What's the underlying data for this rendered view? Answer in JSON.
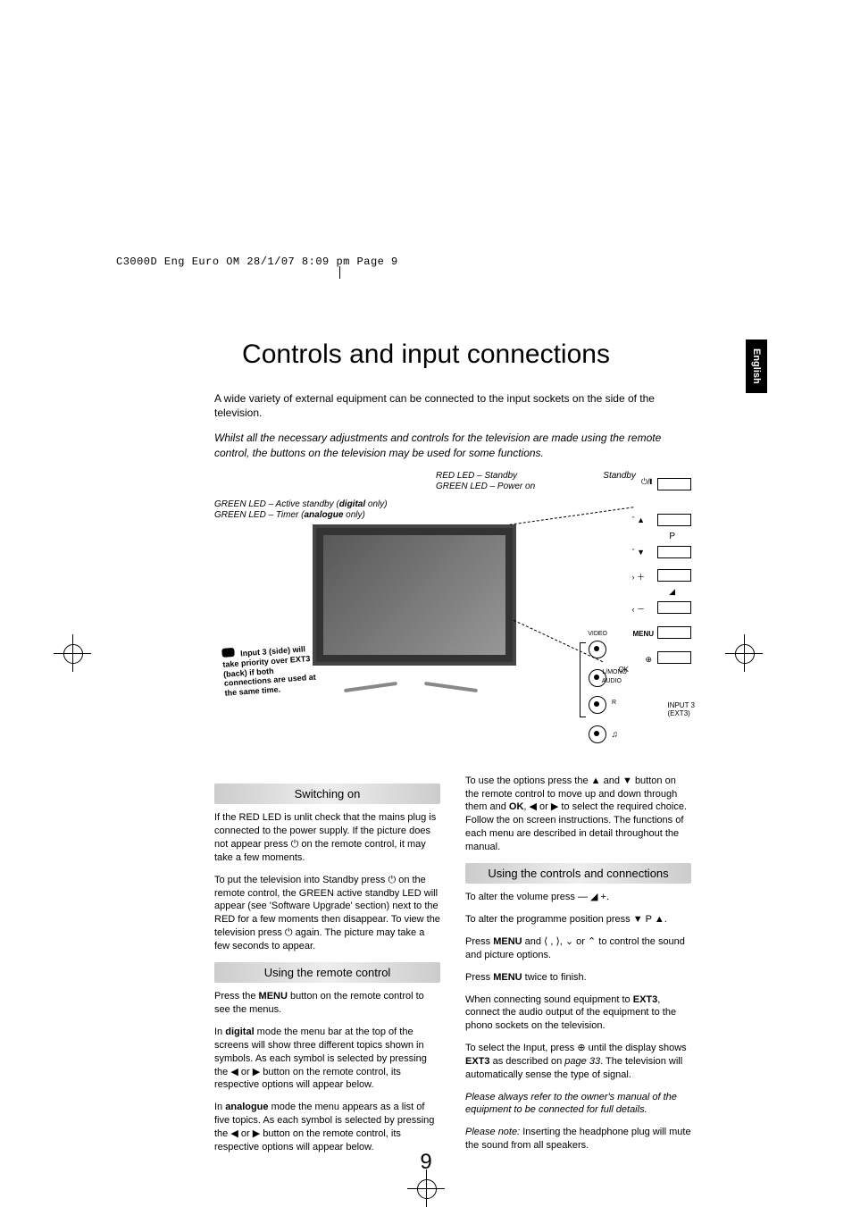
{
  "meta": {
    "print_header": "C3000D Eng Euro OM  28/1/07  8:09 pm  Page 9"
  },
  "language_tab": "English",
  "title": "Controls and input connections",
  "intro": {
    "line1": "A wide variety of external equipment can be connected to the input sockets on the side of the television.",
    "line2": "Whilst all the necessary adjustments and controls for the television are made using the remote control, the buttons on the television may be used for some functions."
  },
  "diagram": {
    "led_top_a": "RED LED – Standby",
    "led_top_b": "GREEN LED – Power on",
    "standby_label": "Standby",
    "led_left_a_pre": "GREEN LED – Active standby (",
    "led_left_a_bold": "digital",
    "led_left_a_post": " only)",
    "led_left_b_pre": "GREEN LED – Timer (",
    "led_left_b_bold": "analogue",
    "led_left_b_post": " only)",
    "sticky_note": "Input 3 (side) will take priority over EXT3 (back) if both connections are used at the same time.",
    "panel": {
      "p_sym": "P",
      "vol_sym": "◢",
      "menu": "MENU",
      "ok": "OK",
      "input3": "INPUT 3",
      "input3_sub": "(EXT3)",
      "video": "VIDEO",
      "l_mono": "L/MONO",
      "audio": "AUDIO",
      "r": "R",
      "headphone": "♫"
    }
  },
  "sections": {
    "switching_on": {
      "heading": "Switching on",
      "p1": "If the RED LED is unlit check that the mains plug is connected to the power supply. If the picture does not appear press ⏻ on the remote control, it may take a few moments.",
      "p2": "To put the television into Standby press ⏻ on the remote control, the GREEN active standby LED will appear (see 'Software Upgrade' section) next to the RED for a few moments then disappear. To view the television press ⏻ again. The picture may take a few seconds to appear."
    },
    "using_remote": {
      "heading": "Using the remote control",
      "p1_pre": "Press the ",
      "p1_bold": "MENU",
      "p1_post": " button on the remote control to see the menus.",
      "p2_pre": "In ",
      "p2_bold": "digital",
      "p2_mid": " mode the menu bar at the top of the screens will show three different topics shown in symbols. As each symbol is selected by pressing the ◀ or ▶ button on the remote control, its respective options will appear below.",
      "p3_pre": "In ",
      "p3_bold": "analogue",
      "p3_mid": " mode the menu appears as a list of five topics. As each symbol is selected by pressing the ◀ or ▶ button on the remote control, its respective options will appear below."
    },
    "right_top": {
      "p1_pre": "To use the options press the ▲ and ▼ button on the remote control to move up and down through them and ",
      "p1_bold": "OK",
      "p1_post": ", ◀ or ▶ to select the required choice. Follow the on screen instructions. The functions of each menu are described in detail throughout the manual."
    },
    "using_controls": {
      "heading": "Using the controls and connections",
      "p1": "To alter the volume press — ◢ +.",
      "p2": "To alter the programme position press ▼ P ▲.",
      "p3_pre": "Press ",
      "p3_bold": "MENU",
      "p3_post": " and ⟨ , ⟩, ⌄ or ⌃ to control the sound and picture options.",
      "p4_pre": "Press ",
      "p4_bold": "MENU",
      "p4_post": " twice to finish.",
      "p5_pre": "When connecting sound equipment to ",
      "p5_bold": "EXT3",
      "p5_post": ", connect the audio output of the equipment to the phono sockets on the television.",
      "p6_pre": "To select the Input, press ⊕ until the display shows ",
      "p6_bold": "EXT3",
      "p6_mid": " as described on ",
      "p6_ital": "page 33",
      "p6_post": ". The television will automatically sense the type of signal.",
      "p7": "Please always refer to the owner's manual of the equipment to be connected for full details.",
      "p8_pre": "Please note:",
      "p8_post": " Inserting the headphone plug will mute the sound from all speakers."
    }
  },
  "page_number": "9"
}
